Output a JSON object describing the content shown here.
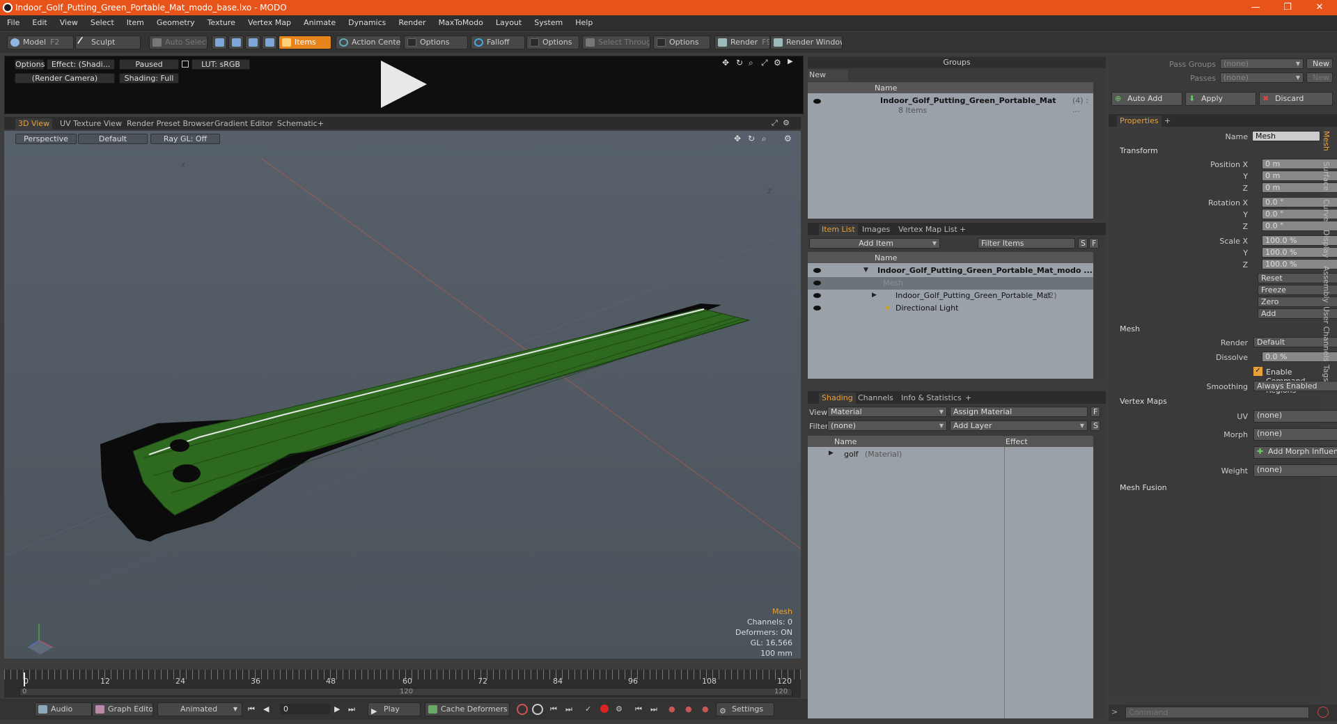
{
  "window": {
    "title": "Indoor_Golf_Putting_Green_Portable_Mat_modo_base.lxo - MODO",
    "min": "—",
    "max": "❐",
    "close": "✕"
  },
  "menu": [
    "File",
    "Edit",
    "View",
    "Select",
    "Item",
    "Geometry",
    "Texture",
    "Vertex Map",
    "Animate",
    "Dynamics",
    "Render",
    "MaxToModo",
    "Layout",
    "System",
    "Help"
  ],
  "toolbar": {
    "model": "Model",
    "model_hotkey": "F2",
    "sculpt": "Sculpt",
    "auto_select": "Auto Select",
    "items": "Items",
    "action_center": "Action Center",
    "options1": "Options",
    "falloff": "Falloff",
    "options2": "Options",
    "select_through": "Select Through",
    "options3": "Options",
    "render": "Render",
    "render_hotkey": "F9",
    "render_window": "Render Window"
  },
  "preview": {
    "options": "Options",
    "effect": "Effect: (Shadi...",
    "paused": "Paused",
    "lut": "LUT: sRGB",
    "camera": "(Render Camera)",
    "shading": "Shading: Full"
  },
  "viewport_tabs": [
    "3D View",
    "UV Texture View",
    "Render Preset Browser",
    "Gradient Editor",
    "Schematic",
    "+"
  ],
  "viewport": {
    "perspective": "Perspective",
    "default": "Default",
    "raygl": "Ray GL: Off",
    "axis_x": "X",
    "axis_z": "Z",
    "stats": {
      "title": "Mesh",
      "channels": "Channels: 0",
      "deformers": "Deformers: ON",
      "gl": "GL: 16,566",
      "scale": "100 mm"
    }
  },
  "timeline": {
    "ticks": [
      "0",
      "12",
      "24",
      "36",
      "48",
      "60",
      "72",
      "84",
      "96",
      "108",
      "120"
    ],
    "range_start": "0",
    "range_mid": "120",
    "range_end": "120"
  },
  "bottom": {
    "audio": "Audio",
    "graph_editor": "Graph Editor",
    "animated": "Animated",
    "frame": "0",
    "play": "Play",
    "cache_deformers": "Cache Deformers",
    "settings": "Settings"
  },
  "groups": {
    "title": "Groups",
    "new_group": "New Group",
    "col_name": "Name",
    "item_name": "Indoor_Golf_Putting_Green_Portable_Mat",
    "item_count": "(4) : ...",
    "item_sub": "8 Items"
  },
  "itemlist": {
    "tabs": [
      "Item List",
      "Images",
      "Vertex Map List",
      "+"
    ],
    "add_item": "Add Item",
    "filter": "Filter Items",
    "s": "S",
    "f": "F",
    "col_name": "Name",
    "rows": [
      {
        "name": "Indoor_Golf_Putting_Green_Portable_Mat_modo ...",
        "extra": ""
      },
      {
        "name": "Mesh",
        "extra": ""
      },
      {
        "name": "Indoor_Golf_Putting_Green_Portable_Mat",
        "extra": "(2)"
      },
      {
        "name": "Directional Light",
        "extra": ""
      }
    ]
  },
  "shading": {
    "tabs": [
      "Shading",
      "Channels",
      "Info & Statistics",
      "+"
    ],
    "view_label": "View",
    "view_value": "Material",
    "assign": "Assign Material",
    "f": "F",
    "filter_label": "Filter",
    "filter_value": "(none)",
    "add_layer": "Add Layer",
    "s": "S",
    "col_name": "Name",
    "col_effect": "Effect",
    "row_name": "golf",
    "row_type": "(Material)"
  },
  "pass": {
    "pass_groups": "Pass Groups",
    "pass_groups_value": "(none)",
    "new1": "New",
    "passes": "Passes",
    "passes_value": "(none)",
    "new2": "New",
    "auto_add": "Auto Add",
    "apply": "Apply",
    "discard": "Discard"
  },
  "properties": {
    "tab": "Properties",
    "plus": "+",
    "name_label": "Name",
    "name_value": "Mesh",
    "transform": "Transform",
    "pos_label": "Position X",
    "y": "Y",
    "z": "Z",
    "pos": [
      "0 m",
      "0 m",
      "0 m"
    ],
    "rot_label": "Rotation X",
    "rot": [
      "0.0 °",
      "0.0 °",
      "0.0 °"
    ],
    "scale_label": "Scale X",
    "scale": [
      "100.0 %",
      "100.0 %",
      "100.0 %"
    ],
    "reset": "Reset",
    "freeze": "Freeze",
    "zero": "Zero",
    "add": "Add",
    "mesh": "Mesh",
    "render_label": "Render",
    "render_value": "Default",
    "dissolve_label": "Dissolve",
    "dissolve_value": "0.0 %",
    "enable_cmd": "Enable Command Regions",
    "smoothing_label": "Smoothing",
    "smoothing_value": "Always Enabled",
    "vertex_maps": "Vertex Maps",
    "uv_label": "UV",
    "uv_value": "(none)",
    "morph_label": "Morph",
    "morph_value": "(none)",
    "add_morph": "Add Morph Influence",
    "weight_label": "Weight",
    "weight_value": "(none)",
    "mesh_fusion": "Mesh Fusion",
    "side_tabs": [
      "Mesh",
      "Surface",
      "Curve",
      "Display",
      "Assembly",
      "User Channels",
      "Tags"
    ]
  },
  "command": {
    "placeholder": "Command"
  },
  "colors": {
    "accent": "#e8841c",
    "title_bar": "#e8531a",
    "mesh_green": "#2f6b1f"
  }
}
